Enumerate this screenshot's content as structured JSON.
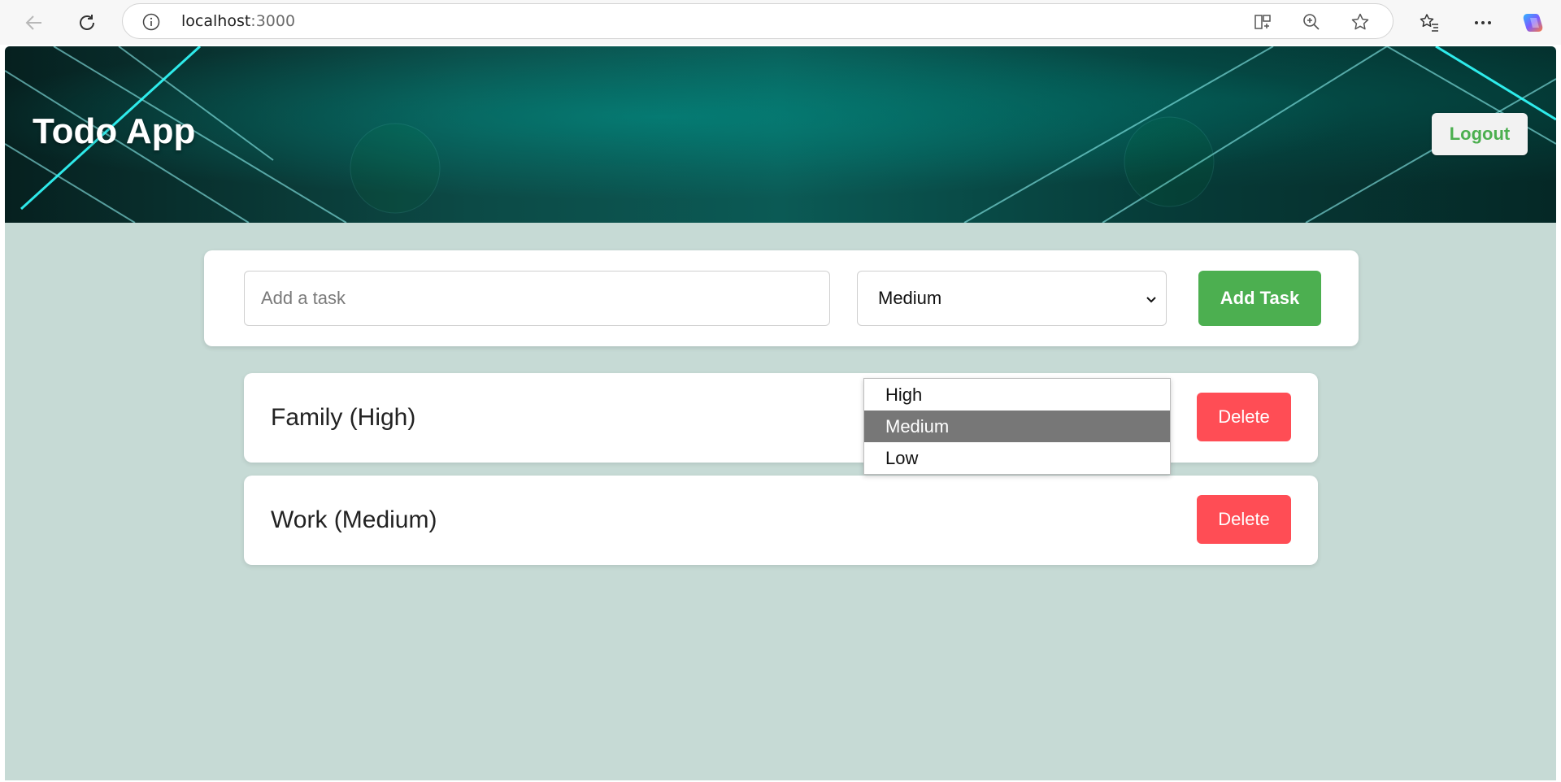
{
  "browser": {
    "url_host": "localhost",
    "url_port": ":3000"
  },
  "header": {
    "title": "Todo App",
    "logout_label": "Logout"
  },
  "add_form": {
    "input_placeholder": "Add a task",
    "input_value": "",
    "priority_selected": "Medium",
    "add_label": "Add Task"
  },
  "priority_dropdown": {
    "options": [
      "High",
      "Medium",
      "Low"
    ],
    "highlighted": "Medium"
  },
  "tasks": [
    {
      "label": "Family (High)",
      "delete_label": "Delete"
    },
    {
      "label": "Work (Medium)",
      "delete_label": "Delete"
    }
  ],
  "colors": {
    "page_bg": "#c6dad5",
    "accent_green": "#4caf50",
    "delete_red": "#ff4d55",
    "highlight_gray": "#777777"
  }
}
